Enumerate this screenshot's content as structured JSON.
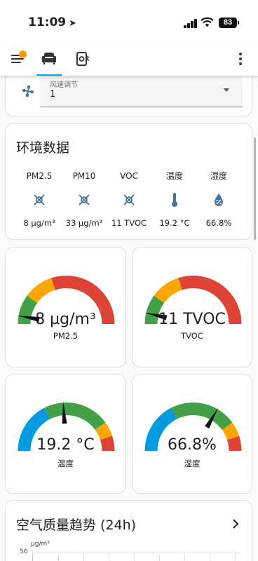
{
  "status_bar": {
    "time": "11:09",
    "battery": "83"
  },
  "control": {
    "label": "风速调节",
    "value": "1"
  },
  "environment": {
    "title": "环境数据",
    "sensors": [
      {
        "name": "PM2.5",
        "value": "8 µg/m³",
        "icon": "pm25-icon"
      },
      {
        "name": "PM10",
        "value": "33 µg/m³",
        "icon": "pm10-icon"
      },
      {
        "name": "VOC",
        "value": "11 TVOC",
        "icon": "voc-icon"
      },
      {
        "name": "温度",
        "value": "19.2 °C",
        "icon": "thermometer-icon"
      },
      {
        "name": "湿度",
        "value": "66.8%",
        "icon": "water-percent-icon"
      }
    ]
  },
  "gauges": [
    {
      "name": "PM2.5",
      "display": "8 µg/m³",
      "value": 8,
      "min": 0,
      "max": 150,
      "type": "severity"
    },
    {
      "name": "TVOC",
      "display": "11 TVOC",
      "value": 11,
      "min": 0,
      "max": 150,
      "type": "severity"
    },
    {
      "name": "温度",
      "display": "19.2 °C",
      "value": 19.2,
      "min": 0,
      "max": 40,
      "type": "comfort"
    },
    {
      "name": "湿度",
      "display": "66.8%",
      "value": 66.8,
      "min": 0,
      "max": 100,
      "type": "comfort"
    }
  ],
  "trend": {
    "title": "空气质量趋势 (24h)",
    "unit": "µg/m³",
    "first_tick": "50"
  },
  "colors": {
    "green": "#43a047",
    "orange": "#ffa600",
    "red": "#db4437",
    "blue": "#039bdf",
    "accent": "#03a9f4",
    "notification": "#ff9800",
    "icon_blue": "#44739e"
  }
}
